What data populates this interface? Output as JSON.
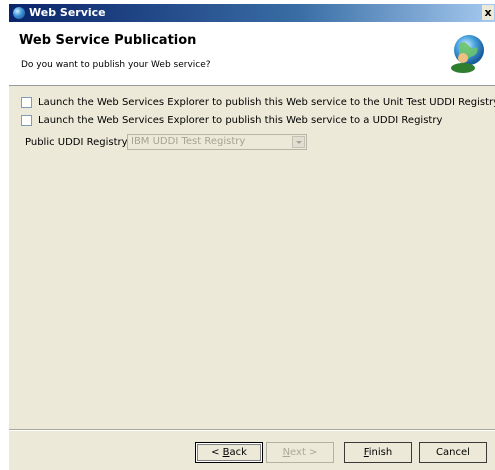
{
  "window": {
    "title": "Web Service",
    "close_glyph": "x"
  },
  "header": {
    "title": "Web Service Publication",
    "subtitle": "Do you want to publish your Web service?",
    "icon": "globe-person-icon"
  },
  "options": [
    {
      "label": "Launch the Web Services Explorer to publish this Web service to the Unit Test UDDI Registry",
      "checked": false
    },
    {
      "label": "Launch the Web Services Explorer to publish this Web service to a UDDI Registry",
      "checked": false
    }
  ],
  "registry": {
    "label": "Public UDDI Registry",
    "selected": "IBM UDDI Test Registry",
    "enabled": false
  },
  "buttons": {
    "back": {
      "mnemonic": "B",
      "rest": "ack",
      "prefix": "< "
    },
    "next": {
      "mnemonic": "N",
      "rest": "ext",
      "suffix": " >"
    },
    "finish": {
      "mnemonic": "F",
      "rest": "inish"
    },
    "cancel": {
      "label": "Cancel"
    }
  }
}
